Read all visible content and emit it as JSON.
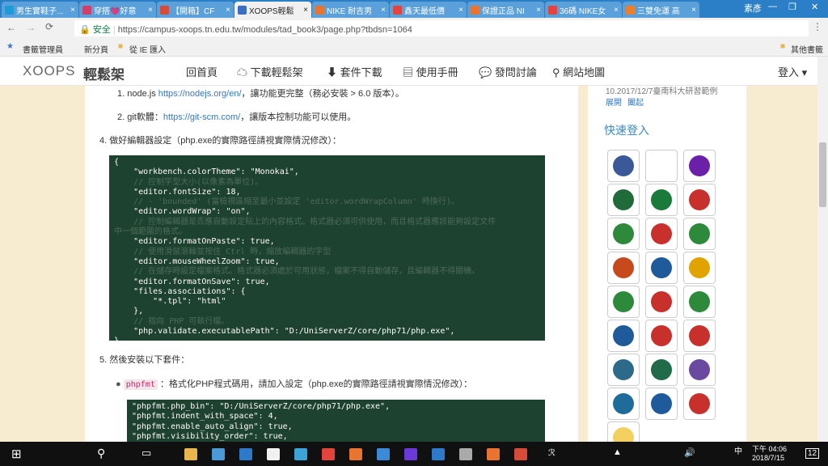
{
  "tabs": [
    {
      "label": "男生實鞋子..."
    },
    {
      "label": "穿搭💗好意"
    },
    {
      "label": "【開箱】CF"
    },
    {
      "label": "XOOPS輕鬆"
    },
    {
      "label": "NIKE 耐吉男"
    },
    {
      "label": "鑫天最低價"
    },
    {
      "label": "保證正品 NI"
    },
    {
      "label": "36碼 NIKE女"
    },
    {
      "label": "三雙免運 高"
    }
  ],
  "window_user": "素彥",
  "browser": {
    "secure_label": "安全",
    "url": "https://campus-xoops.tn.edu.tw/modules/tad_book3/page.php?tbdsn=1064"
  },
  "bookmarks": [
    "書籤管理員",
    "新分頁",
    "從 IE 匯入",
    "其他書籤"
  ],
  "site": {
    "logo_text": "XOOPS",
    "logo_cn": "輕鬆架",
    "nav": [
      "回首頁",
      "下載輕鬆架",
      "套件下載",
      "使用手冊",
      "發問討論",
      "網站地圖"
    ],
    "login": "登入"
  },
  "content": {
    "item1_prefix": "1. node.js ",
    "item1_link": "https://nodejs.org/en/",
    "item1_suffix": "，讓功能更完整（務必安裝 > 6.0 版本）。",
    "item2_prefix": "2. git軟體：",
    "item2_link": "https://git-scm.com/",
    "item2_suffix": "，讓版本控制功能可以使用。",
    "step4": "4. 做好編輯器設定（php.exe的實際路徑請視實際情況修改）：",
    "step5": "5. 然後安裝以下套件：",
    "phpfmt_tag": "phpfmt",
    "phpfmt_desc": "：格式化PHP程式碼用，請加入設定（php.exe的實際路徑請視實際情況修改）："
  },
  "code1": [
    {
      "t": "{"
    },
    {
      "t": "    \"workbench.colorTheme\": \"Monokai\","
    },
    {
      "t": "    // 控制字型大小(以像素為單位)。",
      "c": true
    },
    {
      "t": "    \"editor.fontSize\": 18,"
    },
    {
      "t": "    // - 'bounded' (當檢視區縮至最小並設定 'editor.wordWrapColumn' 時換行)。",
      "c": true
    },
    {
      "t": "    \"editor.wordWrap\": \"on\","
    },
    {
      "t": "    // 控制編輯器是否應自動設定貼上的內容格式。格式器必須可供使用，而且格式器應該能夠設定文件",
      "c": true
    },
    {
      "t": "中一個範圍的格式。",
      "c": true
    },
    {
      "t": "    \"editor.formatOnPaste\": true,"
    },
    {
      "t": "    // 使用滑鼠滾輪並按住 Ctrl 時，縮放編輯器的字型",
      "c": true
    },
    {
      "t": "    \"editor.mouseWheelZoom\": true,"
    },
    {
      "t": "    // 在儲存時設定檔案格式。格式器必須處於可用狀態，檔案不得自動儲存，且編輯器不得關機。",
      "c": true
    },
    {
      "t": "    \"editor.formatOnSave\": true,"
    },
    {
      "t": "    \"files.associations\": {"
    },
    {
      "t": "        \"*.tpl\": \"html\""
    },
    {
      "t": "    },"
    },
    {
      "t": "    // 指向 PHP 可執行檔。",
      "c": true
    },
    {
      "t": "    \"php.validate.executablePath\": \"D:/UniServerZ/core/php71/php.exe\","
    },
    {
      "t": "}"
    }
  ],
  "code2": [
    {
      "t": "\"phpfmt.php_bin\": \"D:/UniServerZ/core/php71/php.exe\","
    },
    {
      "t": "\"phpfmt.indent_with_space\": 4,"
    },
    {
      "t": "\"phpfmt.enable_auto_align\": true,"
    },
    {
      "t": "\"phpfmt.visibility_order\": true,"
    }
  ],
  "sidebar": {
    "top_text": "10.2017/12/7臺南科大研習範例",
    "links": [
      "展開",
      "闔起"
    ],
    "quick_login": "快速登入"
  },
  "taskbar": {
    "time": "下午 04:06",
    "date": "2018/7/15",
    "notif": "12"
  },
  "colors": {
    "accent": "#3278c6",
    "code_bg": "#1e4230",
    "chrome_tab": "#2a7fc6"
  }
}
